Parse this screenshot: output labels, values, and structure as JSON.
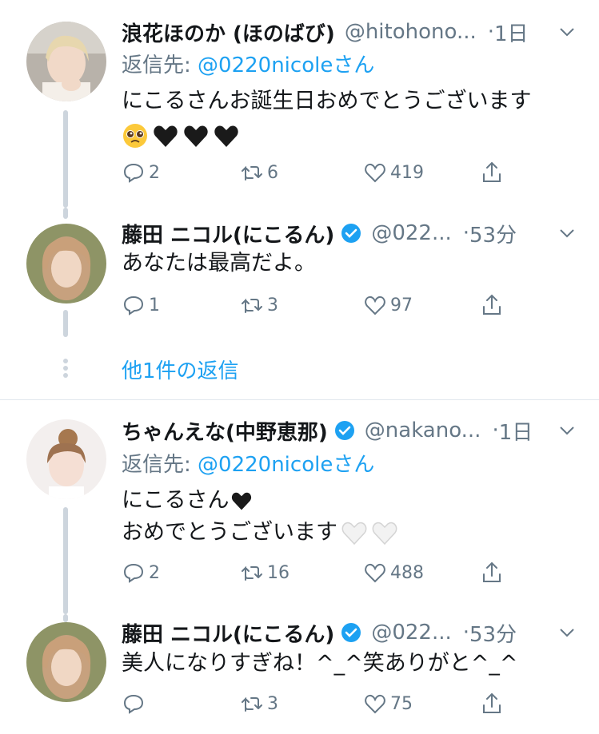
{
  "tweets": [
    {
      "name": "浪花ほのか (ほのばび)",
      "handle": "@hitohono...",
      "sep": "·",
      "time": "1日",
      "verified": false,
      "reply_prefix": "返信先: ",
      "reply_mention": "@0220nicoleさん",
      "lines": [
        "にこるさんお誕生日おめでとうございます"
      ],
      "emoji_line": [
        "pleading-face",
        "black-heart",
        "black-heart",
        "black-heart"
      ],
      "replies": "2",
      "retweets": "6",
      "likes": "419"
    },
    {
      "name": "藤田 ニコル(にこるん)",
      "handle": "@022...",
      "sep": "·",
      "time": "53分",
      "verified": true,
      "lines": [
        "あなたは最高だよ。"
      ],
      "replies": "1",
      "retweets": "3",
      "likes": "97"
    },
    {
      "name": "ちゃんえな(中野恵那)",
      "handle": "@nakano...",
      "sep": "·",
      "time": "1日",
      "verified": true,
      "reply_prefix": "返信先: ",
      "reply_mention": "@0220nicoleさん",
      "lines": [
        "にこるさん",
        "おめでとうございます"
      ],
      "replies": "2",
      "retweets": "16",
      "likes": "488"
    },
    {
      "name": "藤田 ニコル(にこるん)",
      "handle": "@022...",
      "sep": "·",
      "time": "53分",
      "verified": true,
      "lines": [
        "美人になりすぎね！^_^笑ありがと^_^"
      ],
      "replies": "",
      "retweets": "3",
      "likes": "75"
    }
  ],
  "more_replies": "他1件の返信",
  "colors": {
    "accent": "#1da1f2",
    "muted": "#657786",
    "line": "#cdd5dd"
  }
}
